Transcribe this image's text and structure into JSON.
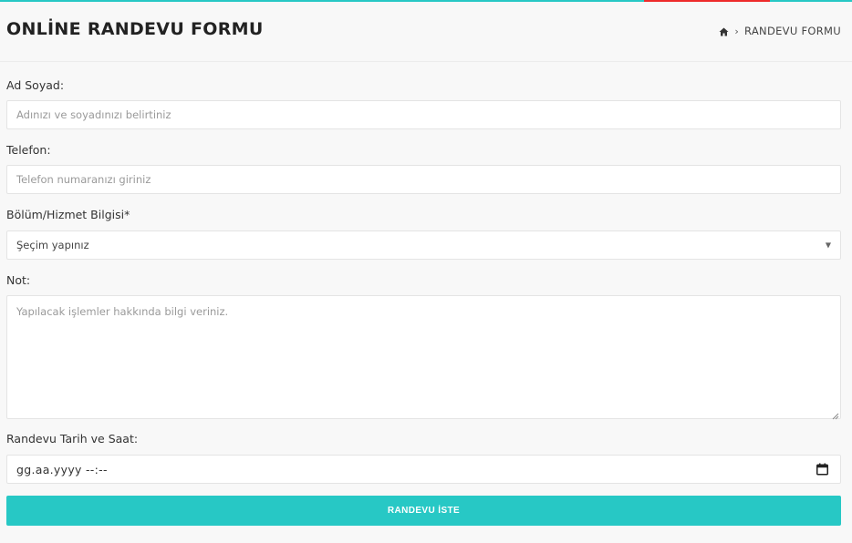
{
  "header": {
    "title": "ONLİNE RANDEVU FORMU",
    "breadcrumb_icon": "home-icon",
    "breadcrumb_current": "RANDEVU FORMU"
  },
  "colors": {
    "accent": "#27c8c5",
    "top_accent_red": "#ee2b2b"
  },
  "form": {
    "name_label": "Ad Soyad:",
    "name_placeholder": "Adınızı ve soyadınızı belirtiniz",
    "phone_label": "Telefon:",
    "phone_placeholder": "Telefon numaranızı giriniz",
    "service_label": "Bölüm/Hizmet Bilgisi*",
    "service_selected": "Şeçim yapınız",
    "note_label": "Not:",
    "note_placeholder": "Yapılacak işlemler hakkında bilgi veriniz.",
    "date_label": "Randevu Tarih ve Saat:",
    "date_value": "gg.aa.yyyy --:--",
    "submit_label": "RANDEVU İSTE"
  }
}
